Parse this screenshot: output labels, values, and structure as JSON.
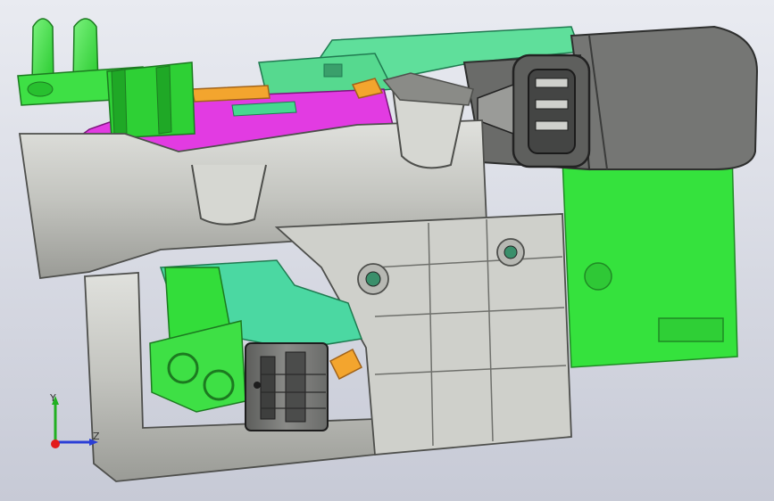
{
  "viewport": {
    "background_top": "#e9ebf1",
    "background_bottom": "#c7cad6"
  },
  "model": {
    "part_colors": {
      "housing": "#bfc0bb",
      "housing_shade": "#8f918c",
      "green_part": "#33dd3a",
      "green_dark": "#1c9a22",
      "teal_part": "#4fd7a0",
      "magenta_part": "#e02ee0",
      "orange_part": "#f1a12b",
      "connector": "#6f706e",
      "connector_dark": "#434443",
      "switch_block": "#5a5b59"
    }
  },
  "triad": {
    "x_axis_color": "#e21b1b",
    "y_axis_color": "#21b021",
    "z_axis_color": "#2b3fd6",
    "labels": {
      "y": "Y",
      "z": "Z"
    }
  }
}
